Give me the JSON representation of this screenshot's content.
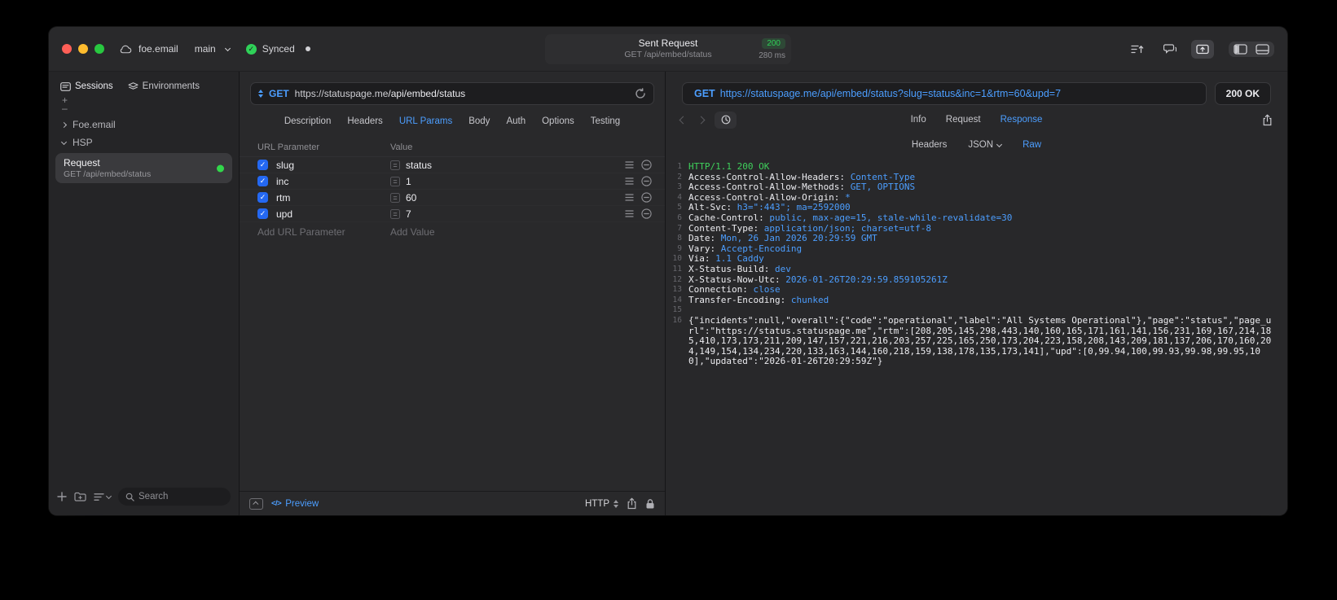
{
  "titlebar": {
    "account": "foe.email",
    "branch": "main",
    "sync": "Synced",
    "request_summary": {
      "title": "Sent Request",
      "status": "200",
      "method_path": "GET /api/embed/status",
      "duration": "280 ms"
    }
  },
  "sidebar": {
    "tabs": [
      {
        "label": "Sessions"
      },
      {
        "label": "Environments"
      }
    ],
    "add_label": "+",
    "remove_label": "–",
    "tree": [
      {
        "label": "Foe.email",
        "state": "collapsed"
      },
      {
        "label": "HSP",
        "state": "expanded"
      }
    ],
    "request": {
      "title": "Request",
      "subtitle": "GET /api/embed/status"
    },
    "search_placeholder": "Search"
  },
  "request_panel": {
    "method": "GET",
    "url_host": "https://statuspage.me",
    "url_path": "/api/embed/status",
    "tabs": [
      "Description",
      "Headers",
      "URL Params",
      "Body",
      "Auth",
      "Options",
      "Testing"
    ],
    "active_tab": "URL Params",
    "param_table": {
      "columns": [
        "URL Parameter",
        "Value"
      ],
      "rows": [
        {
          "name": "slug",
          "value": "status"
        },
        {
          "name": "inc",
          "value": "1"
        },
        {
          "name": "rtm",
          "value": "60"
        },
        {
          "name": "upd",
          "value": "7"
        }
      ],
      "add_name_placeholder": "Add URL Parameter",
      "add_value_placeholder": "Add Value"
    },
    "footer": {
      "code_glyph": "</>",
      "preview_label": "Preview",
      "protocol": "HTTP"
    }
  },
  "response_panel": {
    "method": "GET",
    "url": "https://statuspage.me/api/embed/status?slug=status&inc=1&rtm=60&upd=7",
    "status": "200 OK",
    "tabs": [
      "Info",
      "Request",
      "Response"
    ],
    "active_tab": "Response",
    "view_tabs": [
      "Headers",
      "JSON",
      "Raw"
    ],
    "active_view": "Raw",
    "lines": [
      {
        "num": "1",
        "parts": [
          {
            "cls": "ok",
            "text": "HTTP/1.1 200 OK"
          }
        ]
      },
      {
        "num": "2",
        "parts": [
          {
            "cls": "name",
            "text": "Access-Control-Allow-Headers: "
          },
          {
            "cls": "val",
            "text": "Content-Type"
          }
        ]
      },
      {
        "num": "3",
        "parts": [
          {
            "cls": "name",
            "text": "Access-Control-Allow-Methods: "
          },
          {
            "cls": "val",
            "text": "GET, OPTIONS"
          }
        ]
      },
      {
        "num": "4",
        "parts": [
          {
            "cls": "name",
            "text": "Access-Control-Allow-Origin: "
          },
          {
            "cls": "val",
            "text": "*"
          }
        ]
      },
      {
        "num": "5",
        "parts": [
          {
            "cls": "name",
            "text": "Alt-Svc: "
          },
          {
            "cls": "val",
            "text": "h3=\":443\"; ma=2592000"
          }
        ]
      },
      {
        "num": "6",
        "parts": [
          {
            "cls": "name",
            "text": "Cache-Control: "
          },
          {
            "cls": "val",
            "text": "public, max-age=15, stale-while-revalidate=30"
          }
        ]
      },
      {
        "num": "7",
        "parts": [
          {
            "cls": "name",
            "text": "Content-Type: "
          },
          {
            "cls": "val",
            "text": "application/json; charset=utf-8"
          }
        ]
      },
      {
        "num": "8",
        "parts": [
          {
            "cls": "name",
            "text": "Date: "
          },
          {
            "cls": "val",
            "text": "Mon, 26 Jan 2026 20:29:59 GMT"
          }
        ]
      },
      {
        "num": "9",
        "parts": [
          {
            "cls": "name",
            "text": "Vary: "
          },
          {
            "cls": "val",
            "text": "Accept-Encoding"
          }
        ]
      },
      {
        "num": "10",
        "parts": [
          {
            "cls": "name",
            "text": "Via: "
          },
          {
            "cls": "val",
            "text": "1.1 Caddy"
          }
        ]
      },
      {
        "num": "11",
        "parts": [
          {
            "cls": "name",
            "text": "X-Status-Build: "
          },
          {
            "cls": "val",
            "text": "dev"
          }
        ]
      },
      {
        "num": "12",
        "parts": [
          {
            "cls": "name",
            "text": "X-Status-Now-Utc: "
          },
          {
            "cls": "val",
            "text": "2026-01-26T20:29:59.859105261Z"
          }
        ]
      },
      {
        "num": "13",
        "parts": [
          {
            "cls": "name",
            "text": "Connection: "
          },
          {
            "cls": "val",
            "text": "close"
          }
        ]
      },
      {
        "num": "14",
        "parts": [
          {
            "cls": "name",
            "text": "Transfer-Encoding: "
          },
          {
            "cls": "val",
            "text": "chunked"
          }
        ]
      },
      {
        "num": "15",
        "parts": []
      },
      {
        "num": "16",
        "parts": [
          {
            "cls": "body",
            "text": "{\"incidents\":null,\"overall\":{\"code\":\"operational\",\"label\":\"All Systems Operational\"},\"page\":\"status\",\"page_url\":\"https://status.statuspage.me\",\"rtm\":[208,205,145,298,443,140,160,165,171,161,141,156,231,169,167,214,185,410,173,173,211,209,147,157,221,216,203,257,225,165,250,173,204,223,158,208,143,209,181,137,206,170,160,204,149,154,134,234,220,133,163,144,160,218,159,138,178,135,173,141],\"upd\":[0,99.94,100,99.93,99.98,99.95,100],\"updated\":\"2026-01-26T20:29:59Z\"}"
          }
        ]
      }
    ]
  }
}
